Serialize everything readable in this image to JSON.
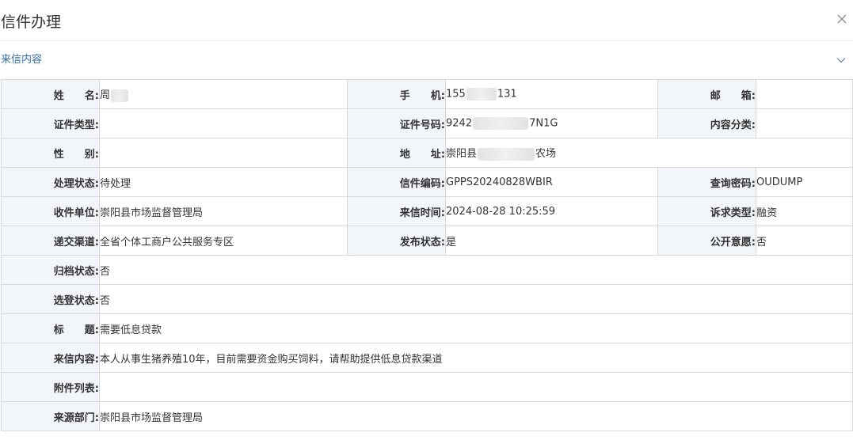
{
  "header": {
    "title": "信件办理",
    "close_icon": "close-icon"
  },
  "section": {
    "title": "来信内容",
    "toggle_icon": "chevron-down-icon"
  },
  "fields": {
    "name": {
      "label": "姓　　名:",
      "value": "周"
    },
    "phone": {
      "label": "手　　机:",
      "value_prefix": "155",
      "value_suffix": "131"
    },
    "email": {
      "label": "邮　　箱:",
      "value": ""
    },
    "id_type": {
      "label": "证件类型:",
      "value": ""
    },
    "id_number": {
      "label": "证件号码:",
      "value_prefix": "9242",
      "value_suffix": "7N1G"
    },
    "category": {
      "label": "内容分类:",
      "value": ""
    },
    "gender": {
      "label": "性　　别:",
      "value": ""
    },
    "address": {
      "label": "地　　址:",
      "value_prefix": "崇阳县",
      "value_suffix": "农场"
    },
    "status": {
      "label": "处理状态:",
      "value": "待处理"
    },
    "letter_code": {
      "label": "信件编码:",
      "value": "GPPS20240828WBIR"
    },
    "query_pwd": {
      "label": "查询密码:",
      "value": "OUDUMP"
    },
    "receiver": {
      "label": "收件单位:",
      "value": "崇阳县市场监督管理局"
    },
    "letter_time": {
      "label": "来信时间:",
      "value": "2024-08-28 10:25:59"
    },
    "appeal_type": {
      "label": "诉求类型:",
      "value": "融资"
    },
    "channel": {
      "label": "递交渠道:",
      "value": "全省个体工商户公共服务专区"
    },
    "publish": {
      "label": "发布状态:",
      "value": "是"
    },
    "public_will": {
      "label": "公开意愿:",
      "value": "否"
    },
    "archive": {
      "label": "归档状态:",
      "value": "否"
    },
    "selected": {
      "label": "选登状态:",
      "value": "否"
    },
    "subject": {
      "label": "标　　题:",
      "value": "需要低息贷款"
    },
    "content": {
      "label": "来信内容:",
      "value": "本人从事生猪养殖10年，目前需要资金购买饲料，请帮助提供低息贷款渠道"
    },
    "attachments": {
      "label": "附件列表:",
      "value": ""
    },
    "source_dept": {
      "label": "来源部门:",
      "value": "崇阳县市场监督管理局"
    }
  }
}
